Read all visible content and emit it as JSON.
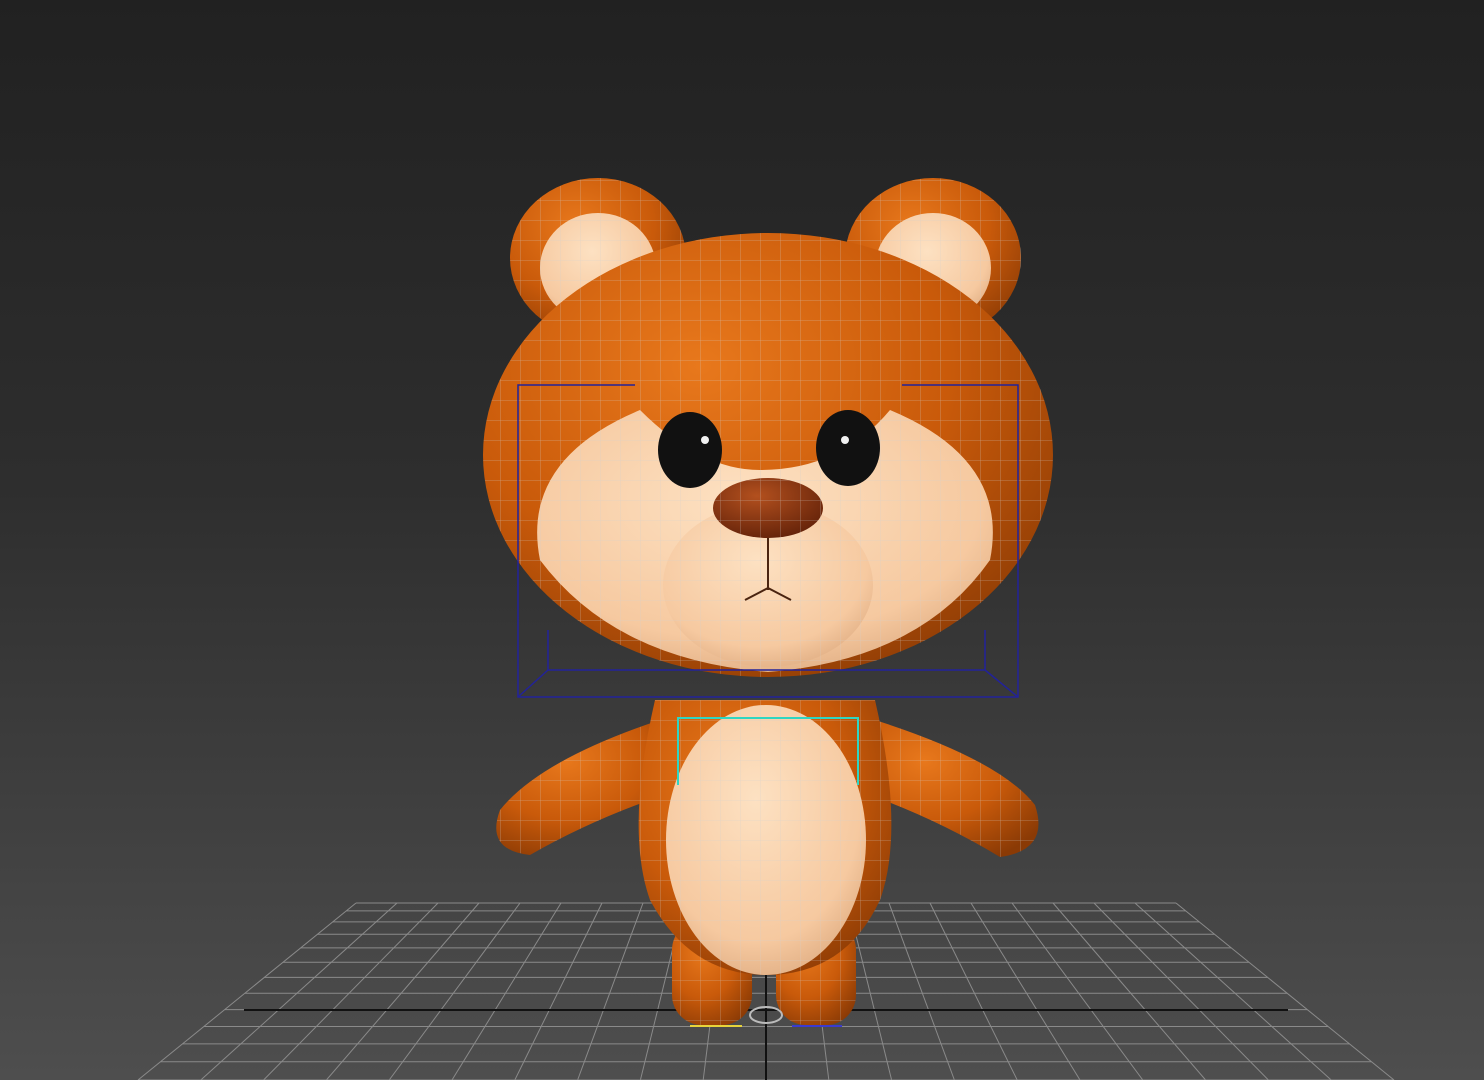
{
  "viewport": {
    "background_top": "#212121",
    "background_bottom": "#4e4e4e",
    "grid_color": "#8a8a8a",
    "axis_color": "#111111"
  },
  "model": {
    "subject": "cartoon-bear",
    "body_color": "#c95a0a",
    "accent_color": "#f6c9a0",
    "eye_color": "#111111",
    "nose_color": "#7a2a0c",
    "wire_color": "#cfcfcf"
  },
  "gizmos": {
    "head_bounds_color": "#22229a",
    "chest_bounds_color": "#2fd6c2",
    "left_foot_color": "#e8d43a",
    "right_foot_color": "#3a3ad0"
  }
}
